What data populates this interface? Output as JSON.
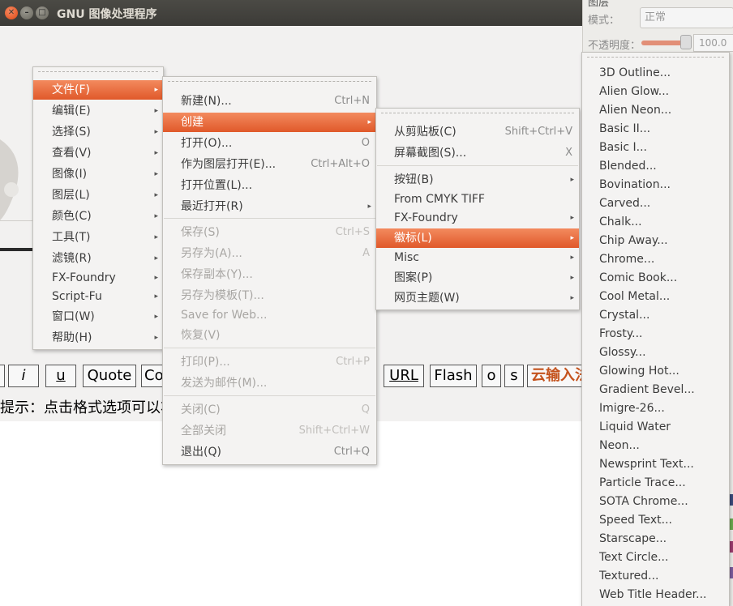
{
  "window": {
    "title": "GNU 图像处理程序",
    "close_glyph": "✕",
    "min_glyph": "–",
    "max_glyph": "□"
  },
  "format_bar": {
    "buttons": [
      "",
      "i",
      "u",
      "Quote",
      "Co",
      "URL",
      "Flash",
      "o",
      "s",
      "云输入法"
    ],
    "hint": "提示：点击格式选项可以将"
  },
  "dock": {
    "top_text": "图层",
    "mode_label": "模式：",
    "mode_value": "正常",
    "opacity_label": "不透明度：",
    "opacity_value": "100.0",
    "opacity_level": 1.0
  },
  "main_menu": {
    "items": [
      {
        "label": "文件(F)",
        "highlighted": true
      },
      {
        "label": "编辑(E)"
      },
      {
        "label": "选择(S)"
      },
      {
        "label": "查看(V)"
      },
      {
        "label": "图像(I)"
      },
      {
        "label": "图层(L)"
      },
      {
        "label": "颜色(C)"
      },
      {
        "label": "工具(T)"
      },
      {
        "label": "滤镜(R)"
      },
      {
        "label": "FX-Foundry"
      },
      {
        "label": "Script-Fu"
      },
      {
        "label": "窗口(W)"
      },
      {
        "label": "帮助(H)"
      }
    ]
  },
  "file_menu": {
    "items": [
      {
        "label": "新建(N)...",
        "accel": "Ctrl+N"
      },
      {
        "label": "创建",
        "submenu": true,
        "highlighted": true
      },
      {
        "label": "打开(O)...",
        "accel": "O"
      },
      {
        "label": "作为图层打开(E)...",
        "accel": "Ctrl+Alt+O"
      },
      {
        "label": "打开位置(L)..."
      },
      {
        "label": "最近打开(R)",
        "submenu": true
      },
      {
        "label": "保存(S)",
        "accel": "Ctrl+S",
        "disabled": true
      },
      {
        "label": "另存为(A)...",
        "accel": "A",
        "disabled": true
      },
      {
        "label": "保存副本(Y)...",
        "disabled": true
      },
      {
        "label": "另存为模板(T)...",
        "disabled": true
      },
      {
        "label": "Save for Web...",
        "disabled": true
      },
      {
        "label": "恢复(V)",
        "disabled": true
      },
      {
        "label": "打印(P)...",
        "accel": "Ctrl+P",
        "disabled": true
      },
      {
        "label": "发送为邮件(M)...",
        "disabled": true
      },
      {
        "label": "关闭(C)",
        "accel": "Q",
        "disabled": true
      },
      {
        "label": "全部关闭",
        "accel": "Shift+Ctrl+W",
        "disabled": true
      },
      {
        "label": "退出(Q)",
        "accel": "Ctrl+Q"
      }
    ]
  },
  "create_menu": {
    "items": [
      {
        "label": "从剪贴板(C)",
        "accel": "Shift+Ctrl+V"
      },
      {
        "label": "屏幕截图(S)...",
        "accel": "X"
      },
      {
        "label": "按钮(B)",
        "submenu": true
      },
      {
        "label": "From CMYK TIFF"
      },
      {
        "label": "FX-Foundry",
        "submenu": true
      },
      {
        "label": "徽标(L)",
        "submenu": true,
        "highlighted": true
      },
      {
        "label": "Misc",
        "submenu": true
      },
      {
        "label": "图案(P)",
        "submenu": true
      },
      {
        "label": "网页主题(W)",
        "submenu": true
      }
    ]
  },
  "logos_menu": {
    "items": [
      "3D Outline...",
      "Alien Glow...",
      "Alien Neon...",
      "Basic II...",
      "Basic I...",
      "Blended...",
      "Bovination...",
      "Carved...",
      "Chalk...",
      "Chip Away...",
      "Chrome...",
      "Comic Book...",
      "Cool Metal...",
      "Crystal...",
      "Frosty...",
      "Glossy...",
      "Glowing Hot...",
      "Gradient Bevel...",
      "Imigre-26...",
      "Liquid Water",
      "Neon...",
      "Newsprint Text...",
      "Particle Trace...",
      "SOTA Chrome...",
      "Speed Text...",
      "Starscape...",
      "Text Circle...",
      "Textured...",
      "Web Title Header..."
    ]
  },
  "colors": {
    "highlight": "#e9683a",
    "titlebar": "#3c3b37",
    "hint_text": "#000000",
    "cloud_input": "#c4521c"
  },
  "icons": {
    "submenu_arrow": "▸"
  }
}
